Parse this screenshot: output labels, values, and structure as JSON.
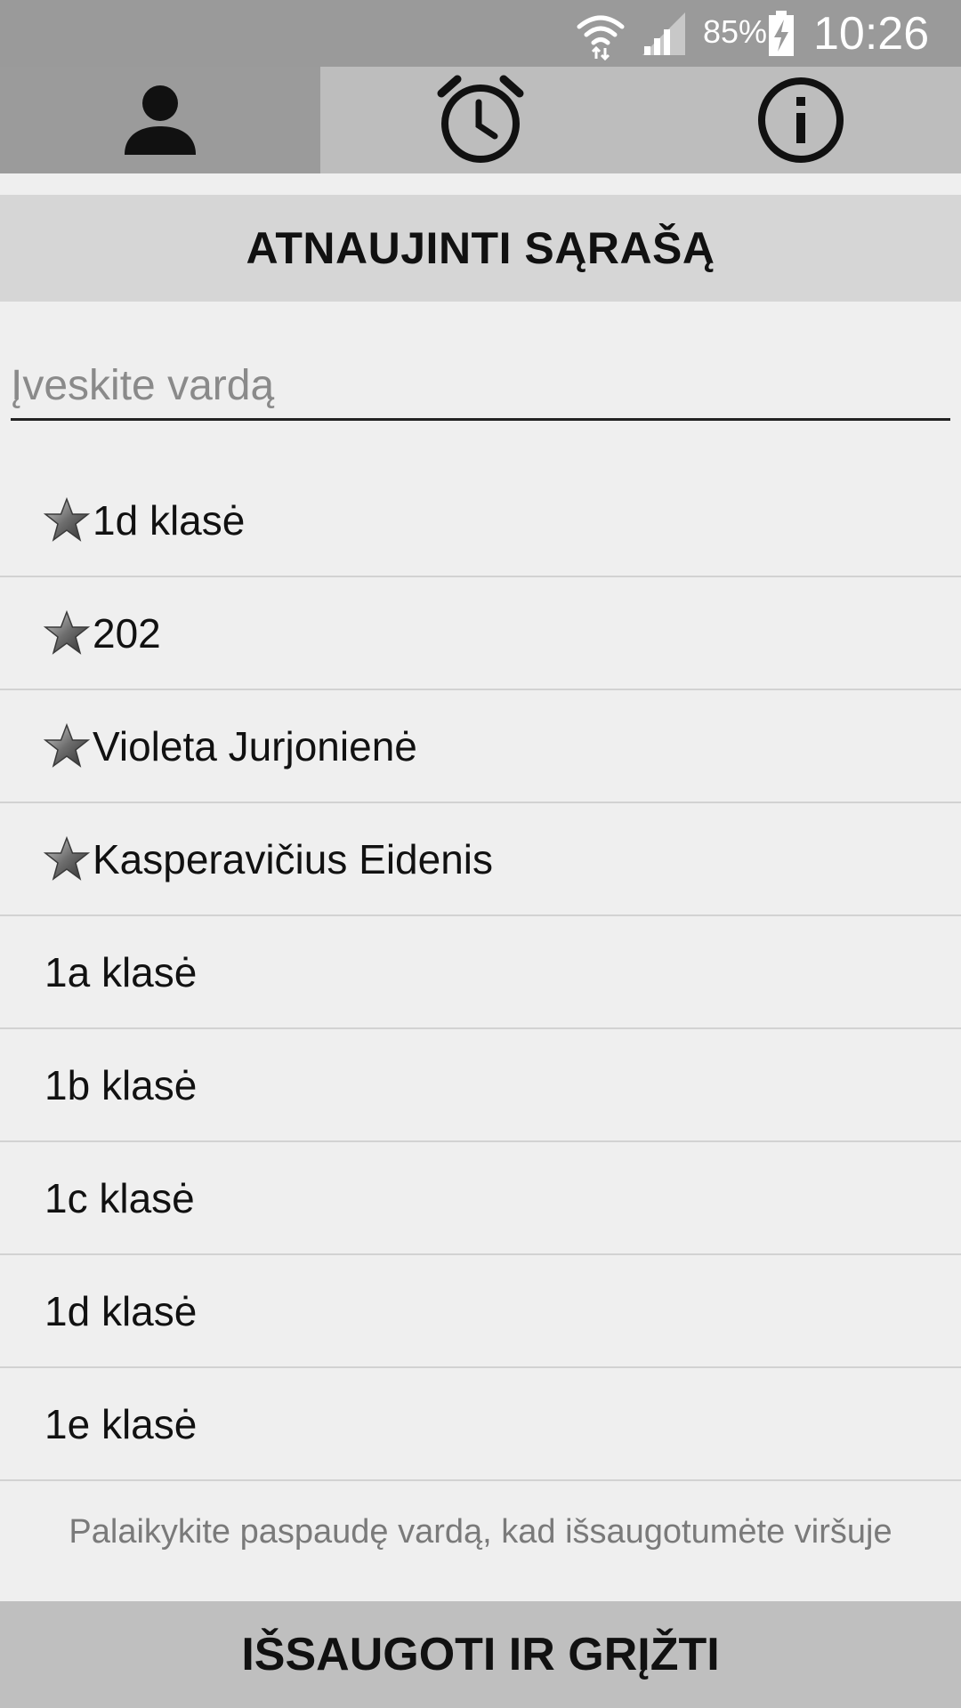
{
  "status_bar": {
    "battery_percent": "85%",
    "time": "10:26",
    "icons": [
      "wifi-icon",
      "signal-icon",
      "battery-charging-icon"
    ]
  },
  "tabs": [
    {
      "name": "person",
      "icon": "person-icon",
      "active": true
    },
    {
      "name": "alarm",
      "icon": "alarm-clock-icon",
      "active": false
    },
    {
      "name": "info",
      "icon": "info-icon",
      "active": false
    }
  ],
  "refresh_button": {
    "label": "ATNAUJINTI SĄRAŠĄ"
  },
  "search": {
    "placeholder": "Įveskite vardą",
    "value": ""
  },
  "list": {
    "items": [
      {
        "label": "1d klasė",
        "favorite": true
      },
      {
        "label": "202",
        "favorite": true
      },
      {
        "label": "Violeta Jurjonienė",
        "favorite": true
      },
      {
        "label": "Kasperavičius Eidenis",
        "favorite": true
      },
      {
        "label": "1a klasė",
        "favorite": false
      },
      {
        "label": "1b klasė",
        "favorite": false
      },
      {
        "label": "1c klasė",
        "favorite": false
      },
      {
        "label": "1d klasė",
        "favorite": false
      },
      {
        "label": "1e klasė",
        "favorite": false
      }
    ]
  },
  "hint": {
    "text": "Palaikykite paspaudę vardą, kad išsaugotumėte viršuje"
  },
  "save_button": {
    "label": "IŠSAUGOTI IR GRĮŽTI"
  },
  "colors": {
    "status_bar": "#9a9a9a",
    "tab_active": "#9b9b9b",
    "tab_inactive": "#bdbdbd",
    "refresh_bg": "#d6d6d6",
    "page_bg": "#efefef",
    "save_bg": "#bfbfbf"
  }
}
